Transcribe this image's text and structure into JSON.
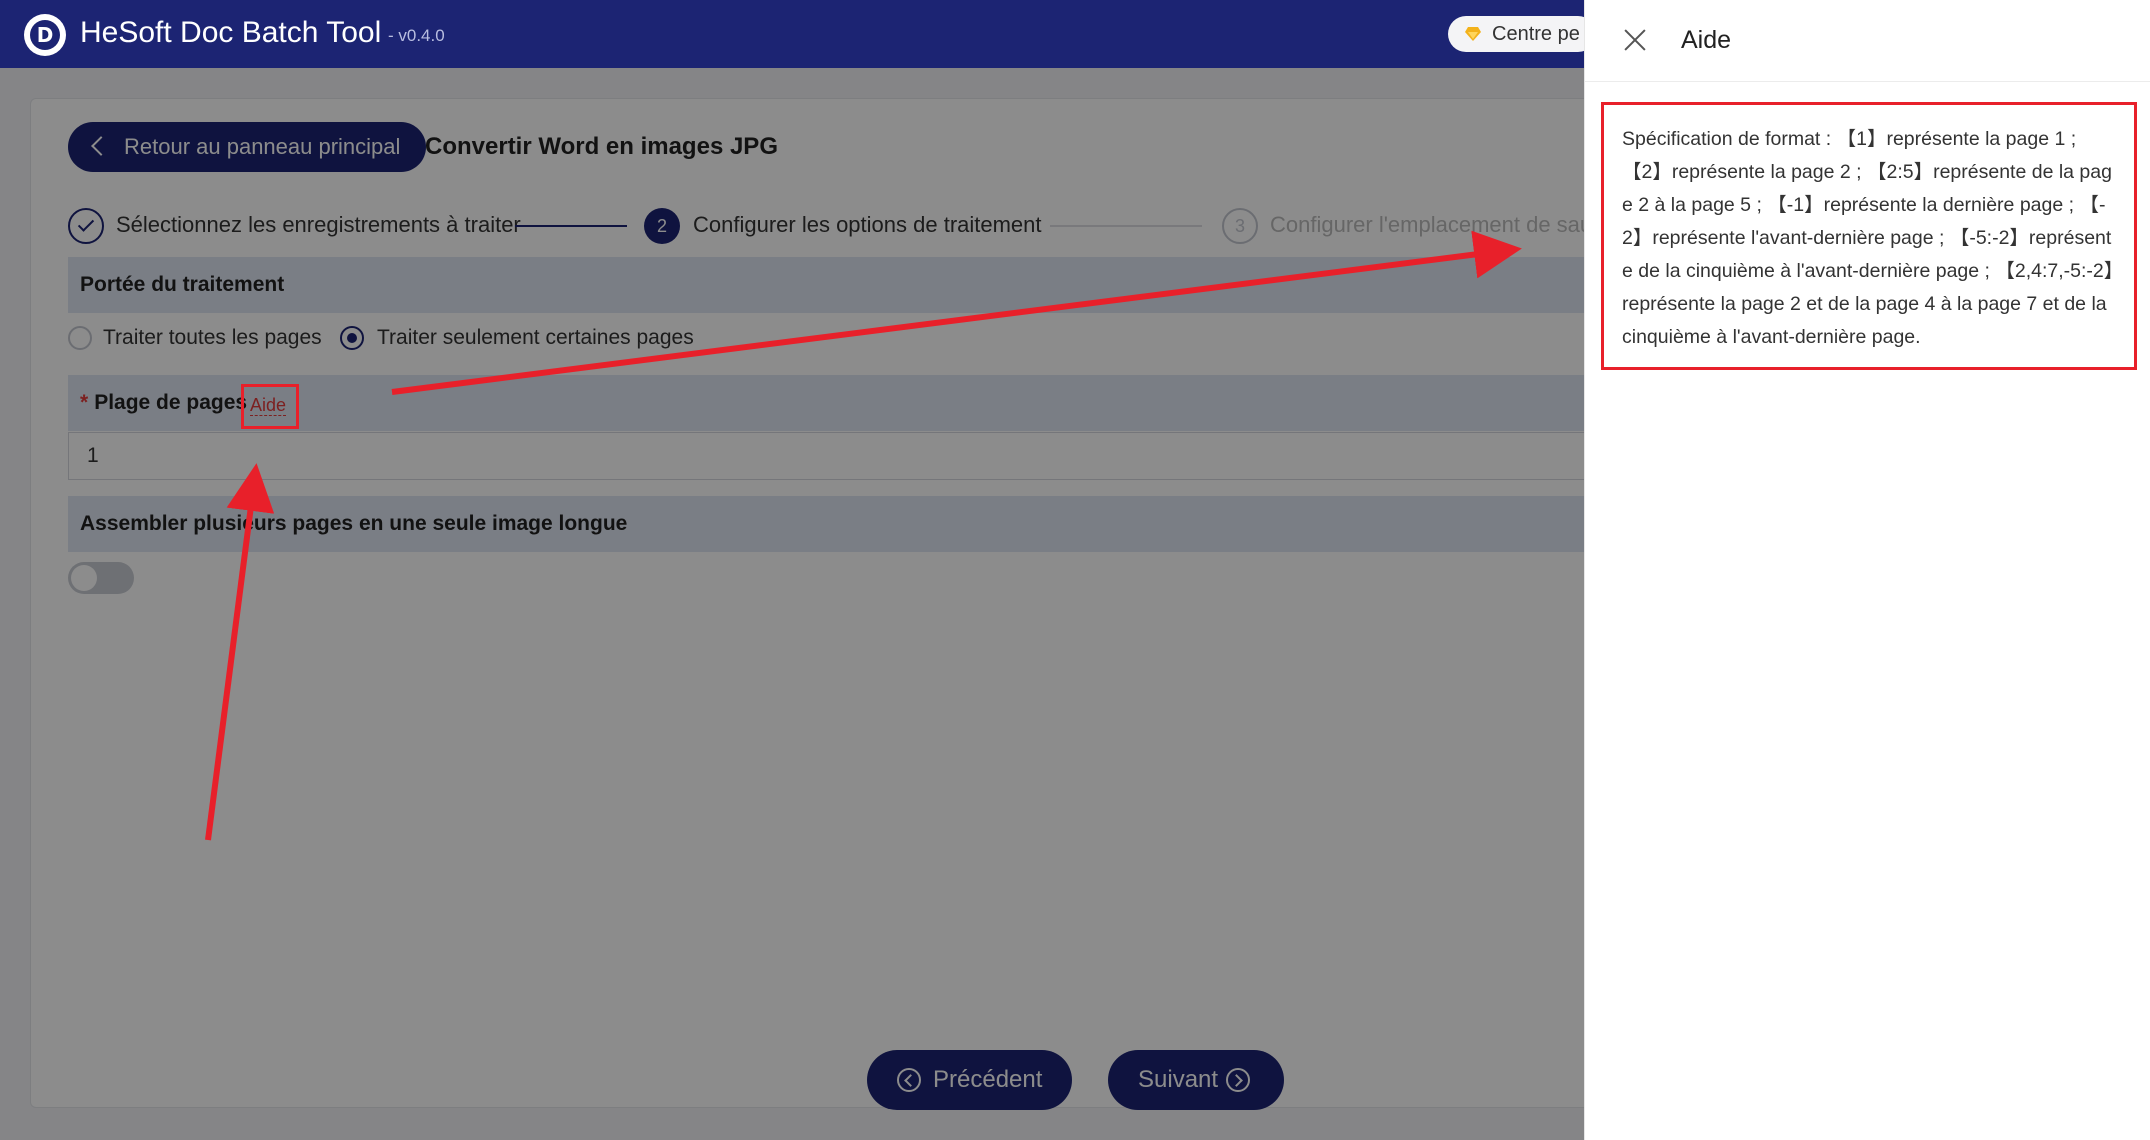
{
  "app": {
    "title": "HeSoft Doc Batch Tool",
    "version": "- v0.4.0",
    "center_label": "Centre pe"
  },
  "header": {
    "back_label": "Retour au panneau principal",
    "page_title": "Convertir Word en images JPG"
  },
  "steps": [
    {
      "number": "1",
      "label": "Sélectionnez les enregistrements à traiter",
      "state": "done"
    },
    {
      "number": "2",
      "label": "Configurer les options de traitement",
      "state": "active"
    },
    {
      "number": "3",
      "label": "Configurer l'emplacement de sauv",
      "state": "pending"
    }
  ],
  "scope": {
    "title": "Portée du traitement",
    "options": [
      {
        "label": "Traiter toutes les pages",
        "checked": false
      },
      {
        "label": "Traiter seulement certaines pages",
        "checked": true
      }
    ]
  },
  "page_range": {
    "required_mark": "*",
    "title": "Plage de pages",
    "help_link": "Aide",
    "value": "1"
  },
  "merge": {
    "title": "Assembler plusieurs pages en une seule image longue",
    "enabled": false
  },
  "footer": {
    "prev_label": "Précédent",
    "next_label": "Suivant"
  },
  "drawer": {
    "title": "Aide",
    "help_text": "Spécification de format : 【1】représente la page 1 ; 【2】représente la page 2 ; 【2:5】représente de la page 2 à la page 5 ; 【-1】représente la dernière page ; 【-2】représente l'avant-dernière page ; 【-5:-2】représente de la cinquième à l'avant-dernière page ; 【2,4:7,-5:-2】représente la page 2 et de la page 4 à la page 7 et de la cinquième à l'avant-dernière page."
  },
  "colors": {
    "brand": "#1c2473",
    "annotation": "#e8202a",
    "section_bg": "#dfe6f3"
  }
}
